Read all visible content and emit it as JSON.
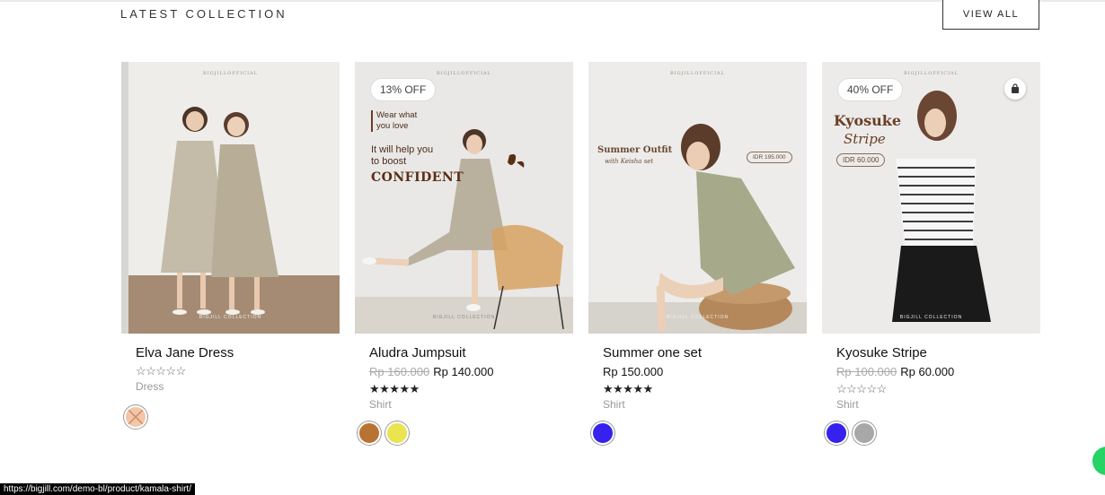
{
  "section": {
    "title": "LATEST COLLECTION",
    "view_all": "VIEW ALL"
  },
  "products": [
    {
      "name": "Elva Jane Dress",
      "price": "",
      "old_price": "",
      "rating_stars": "☆☆☆☆☆",
      "rating": 0,
      "category": "Dress",
      "badge": "",
      "image_text": {
        "brand_top": "BIGJILLOFFICIAL",
        "brand_bottom": "BIGJILL COLLECTION"
      },
      "swatches": [
        {
          "color": "#f3c6a8",
          "unavailable": true
        }
      ]
    },
    {
      "name": "Aludra Jumpsuit",
      "price": "Rp 140.000",
      "old_price": "Rp 160.000",
      "rating_stars": "★★★★★",
      "rating": 5,
      "category": "Shirt",
      "badge": "13% OFF",
      "image_text": {
        "brand_top": "BIGJILLOFFICIAL",
        "brand_bottom": "BIGJILL COLLECTION",
        "promo_line1": "Wear what",
        "promo_line2": "you love",
        "promo_line3": "It will help you",
        "promo_line4": "to boost",
        "promo_line5": "CONFIDENT"
      },
      "swatches": [
        {
          "color": "#b87333"
        },
        {
          "color": "#e9e44f"
        }
      ]
    },
    {
      "name": "Summer one set",
      "price": "Rp 150.000",
      "old_price": "",
      "rating_stars": "★★★★★",
      "rating": 5,
      "category": "Shirt",
      "badge": "",
      "image_text": {
        "brand_top": "BIGJILLOFFICIAL",
        "brand_bottom": "BIGJILL COLLECTION",
        "headline": "Summer Outfit",
        "subline": "with Keisha set",
        "price_tag": "IDR 195.000"
      },
      "swatches": [
        {
          "color": "#3621ee"
        }
      ]
    },
    {
      "name": "Kyosuke Stripe",
      "price": "Rp 60.000",
      "old_price": "Rp 100.000",
      "rating_stars": "☆☆☆☆☆",
      "rating": 0,
      "category": "Shirt",
      "badge": "40% OFF",
      "image_text": {
        "brand_top": "BIGJILLOFFICIAL",
        "brand_bottom": "BIGJILL COLLECTION",
        "headline1": "Kyosuke",
        "headline2": "Stripe",
        "price_tag": "IDR 60.000"
      },
      "swatches": [
        {
          "color": "#3621ee"
        },
        {
          "color": "#a8a8a8"
        }
      ]
    }
  ],
  "status_url": "https://bigjill.com/demo-bl/product/kamala-shirt/",
  "icons": {
    "cart": "shopping-bag-icon",
    "chat": "whatsapp-icon"
  }
}
